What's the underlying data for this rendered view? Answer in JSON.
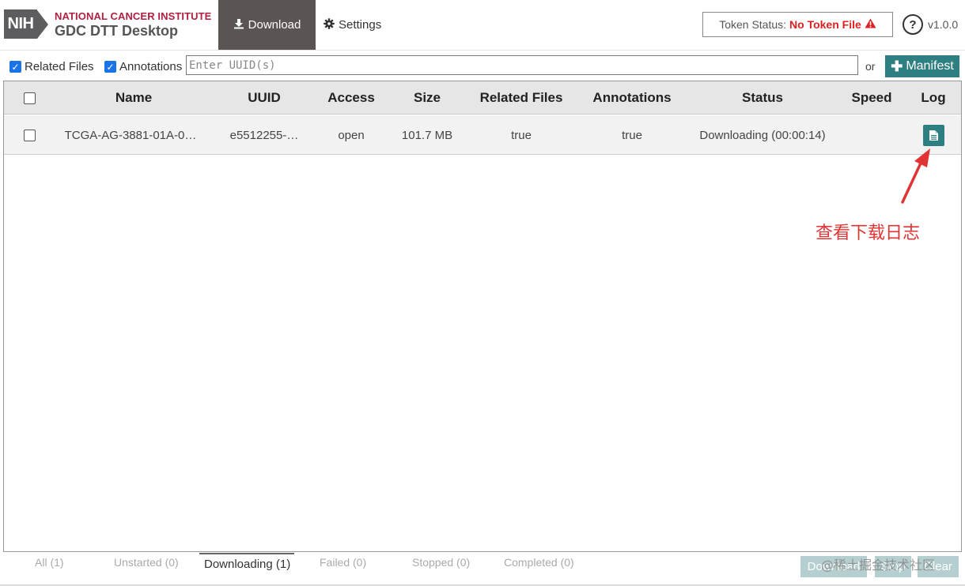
{
  "header": {
    "org_name": "NATIONAL CANCER INSTITUTE",
    "app_name": "GDC DTT Desktop",
    "logo_text": "NIH",
    "nav": [
      {
        "label": "Download",
        "icon": "download-icon",
        "active": true
      },
      {
        "label": "Settings",
        "icon": "gear-icon",
        "active": false
      }
    ],
    "token_label": "Token Status:",
    "token_value": "No Token File",
    "help_label": "?",
    "version": "v1.0.0"
  },
  "toolbar": {
    "related_files_label": "Related Files",
    "related_files_checked": true,
    "annotations_label": "Annotations",
    "annotations_checked": true,
    "uuid_placeholder": "Enter UUID(s)",
    "uuid_value": "",
    "or_label": "or",
    "manifest_label": "Manifest"
  },
  "table": {
    "columns": [
      "Name",
      "UUID",
      "Access",
      "Size",
      "Related Files",
      "Annotations",
      "Status",
      "Speed",
      "Log"
    ],
    "rows": [
      {
        "name": "TCGA-AG-3881-01A-0…",
        "uuid": "e5512255-…",
        "access": "open",
        "size": "101.7 MB",
        "related_files": "true",
        "annotations": "true",
        "status": "Downloading (00:00:14)",
        "speed": ""
      }
    ]
  },
  "annotation": {
    "text": "查看下载日志"
  },
  "tabs": [
    {
      "label": "All (1)",
      "active": false
    },
    {
      "label": "Unstarted (0)",
      "active": false
    },
    {
      "label": "Downloading (1)",
      "active": true
    },
    {
      "label": "Failed (0)",
      "active": false
    },
    {
      "label": "Stopped (0)",
      "active": false
    },
    {
      "label": "Completed (0)",
      "active": false
    }
  ],
  "bottom_buttons": [
    "Download",
    "Stop",
    "Clear"
  ],
  "watermark": "@稀土掘金技术社区",
  "colors": {
    "accent": "#2e7f82",
    "nav_active": "#5a5553",
    "error": "#e02020",
    "brand_red": "#b02041"
  }
}
